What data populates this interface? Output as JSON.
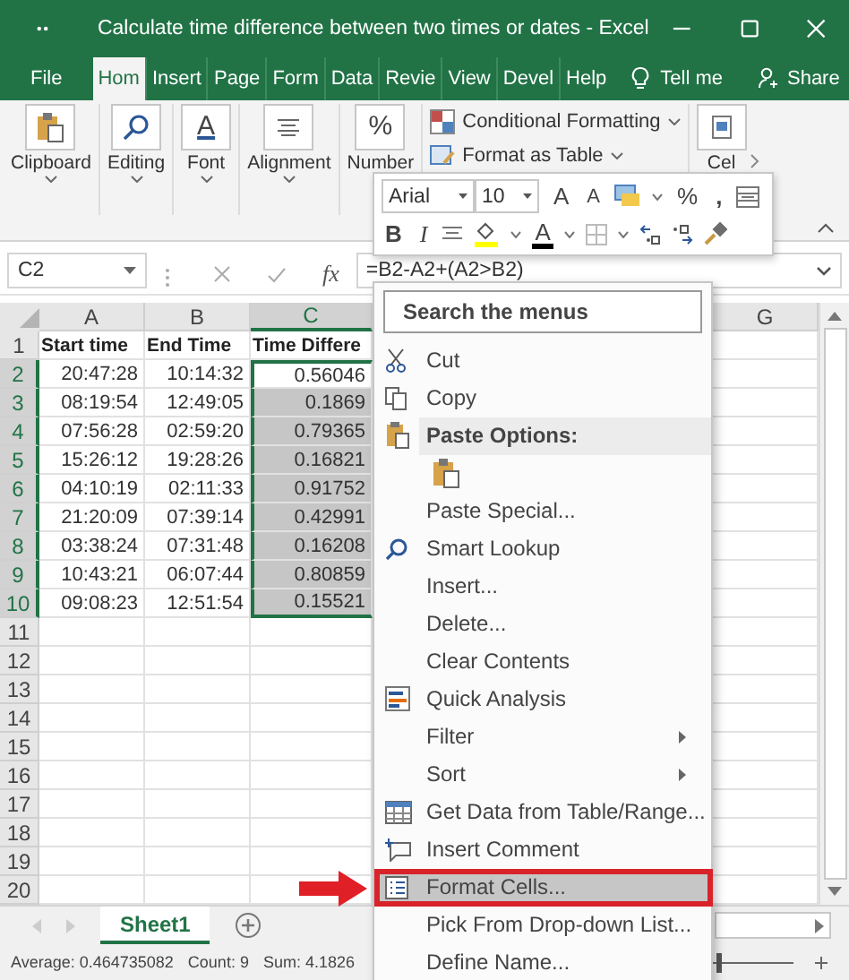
{
  "window": {
    "title": "Calculate time difference between two times or dates  -  Excel"
  },
  "tabs": [
    {
      "label": "File",
      "selected": false
    },
    {
      "label": "Hom",
      "selected": true
    },
    {
      "label": "Insert",
      "selected": false
    },
    {
      "label": "Page",
      "selected": false
    },
    {
      "label": "Form",
      "selected": false
    },
    {
      "label": "Data",
      "selected": false
    },
    {
      "label": "Revie",
      "selected": false
    },
    {
      "label": "View",
      "selected": false
    },
    {
      "label": "Devel",
      "selected": false
    },
    {
      "label": "Help",
      "selected": false
    }
  ],
  "tell_me": "Tell me",
  "share": "Share",
  "ribbon_groups": [
    {
      "label": "Clipboard",
      "kind": "clipboard"
    },
    {
      "label": "Editing",
      "kind": "search"
    },
    {
      "label": "Font",
      "kind": "glyph",
      "glyph": "A"
    },
    {
      "label": "Alignment",
      "kind": "lines"
    },
    {
      "label": "Number",
      "kind": "glyph",
      "glyph": "%"
    }
  ],
  "styles": [
    "Conditional Formatting",
    "Format as Table"
  ],
  "cells_group": "Cel",
  "mini_toolbar": {
    "font": "Arial",
    "size": "10",
    "grow": "A",
    "shrink": "A",
    "percent": "%",
    "comma": ",",
    "bold": "B",
    "italic": "I",
    "font_color": "A"
  },
  "name_box": "C2",
  "fx": "fx",
  "formula": "=B2-A2+(A2>B2)",
  "columns": [
    {
      "label": "A",
      "selected": false
    },
    {
      "label": "B",
      "selected": false
    },
    {
      "label": "C",
      "selected": true
    },
    {
      "label": "G",
      "selected": false
    }
  ],
  "rows": [
    {
      "number": "1",
      "kind": "header",
      "selected": false,
      "cells": [
        "Start time",
        "End Time",
        "Time Differe"
      ]
    },
    {
      "number": "2",
      "kind": "data",
      "selected": true,
      "cells": [
        "20:47:28",
        "10:14:32",
        "0.56046"
      ]
    },
    {
      "number": "3",
      "kind": "data",
      "selected": true,
      "cells": [
        "08:19:54",
        "12:49:05",
        "0.1869"
      ]
    },
    {
      "number": "4",
      "kind": "data",
      "selected": true,
      "cells": [
        "07:56:28",
        "02:59:20",
        "0.79365"
      ]
    },
    {
      "number": "5",
      "kind": "data",
      "selected": true,
      "cells": [
        "15:26:12",
        "19:28:26",
        "0.16821"
      ]
    },
    {
      "number": "6",
      "kind": "data",
      "selected": true,
      "cells": [
        "04:10:19",
        "02:11:33",
        "0.91752"
      ]
    },
    {
      "number": "7",
      "kind": "data",
      "selected": true,
      "cells": [
        "21:20:09",
        "07:39:14",
        "0.42991"
      ]
    },
    {
      "number": "8",
      "kind": "data",
      "selected": true,
      "cells": [
        "03:38:24",
        "07:31:48",
        "0.16208"
      ]
    },
    {
      "number": "9",
      "kind": "data",
      "selected": true,
      "cells": [
        "10:43:21",
        "06:07:44",
        "0.80859"
      ]
    },
    {
      "number": "10",
      "kind": "data",
      "selected": true,
      "cells": [
        "09:08:23",
        "12:51:54",
        "0.15521"
      ]
    },
    {
      "number": "11",
      "kind": "empty",
      "selected": false
    },
    {
      "number": "12",
      "kind": "empty",
      "selected": false
    },
    {
      "number": "13",
      "kind": "empty",
      "selected": false
    },
    {
      "number": "14",
      "kind": "empty",
      "selected": false
    },
    {
      "number": "15",
      "kind": "empty",
      "selected": false
    },
    {
      "number": "16",
      "kind": "empty",
      "selected": false
    },
    {
      "number": "17",
      "kind": "empty",
      "selected": false
    },
    {
      "number": "18",
      "kind": "empty",
      "selected": false
    },
    {
      "number": "19",
      "kind": "empty",
      "selected": false
    },
    {
      "number": "20",
      "kind": "empty",
      "selected": false
    }
  ],
  "context_menu": {
    "search_placeholder": "Search the menus",
    "items": [
      {
        "label": "Cut",
        "kind": "cut",
        "selected": false,
        "callout": false
      },
      {
        "label": "Copy",
        "kind": "copy",
        "selected": false,
        "callout": false
      },
      {
        "label": "Paste Options:",
        "kind": "paste-header",
        "selected": false,
        "callout": false
      },
      {
        "kind": "paste-icon",
        "selected": false,
        "callout": false
      },
      {
        "label": "Paste Special...",
        "kind": "plain",
        "selected": false,
        "callout": false
      },
      {
        "label": "Smart Lookup",
        "kind": "lookup",
        "selected": false,
        "callout": false
      },
      {
        "label": "Insert...",
        "kind": "plain",
        "selected": false,
        "callout": false
      },
      {
        "label": "Delete...",
        "kind": "plain",
        "selected": false,
        "callout": false
      },
      {
        "label": "Clear Contents",
        "kind": "plain",
        "selected": false,
        "callout": false
      },
      {
        "label": "Quick Analysis",
        "kind": "quick",
        "selected": false,
        "callout": false
      },
      {
        "label": "Filter",
        "kind": "submenu",
        "selected": false,
        "callout": false
      },
      {
        "label": "Sort",
        "kind": "submenu",
        "selected": false,
        "callout": false
      },
      {
        "label": "Get Data from Table/Range...",
        "kind": "table",
        "selected": false,
        "callout": false
      },
      {
        "label": "Insert Comment",
        "kind": "comment",
        "selected": false,
        "callout": false
      },
      {
        "label": "Format Cells...",
        "kind": "format",
        "selected": true,
        "callout": true
      },
      {
        "label": "Pick From Drop-down List...",
        "kind": "plain",
        "selected": false,
        "callout": false
      },
      {
        "label": "Define Name...",
        "kind": "plain",
        "selected": false,
        "callout": false
      }
    ]
  },
  "sheet_tabs": [
    {
      "label": "Sheet1",
      "selected": true
    }
  ],
  "status_bar": [
    "Average: 0.464735082",
    "Count: 9",
    "Sum: 4.1826"
  ],
  "zoom_slider": {
    "level": 0.57
  }
}
